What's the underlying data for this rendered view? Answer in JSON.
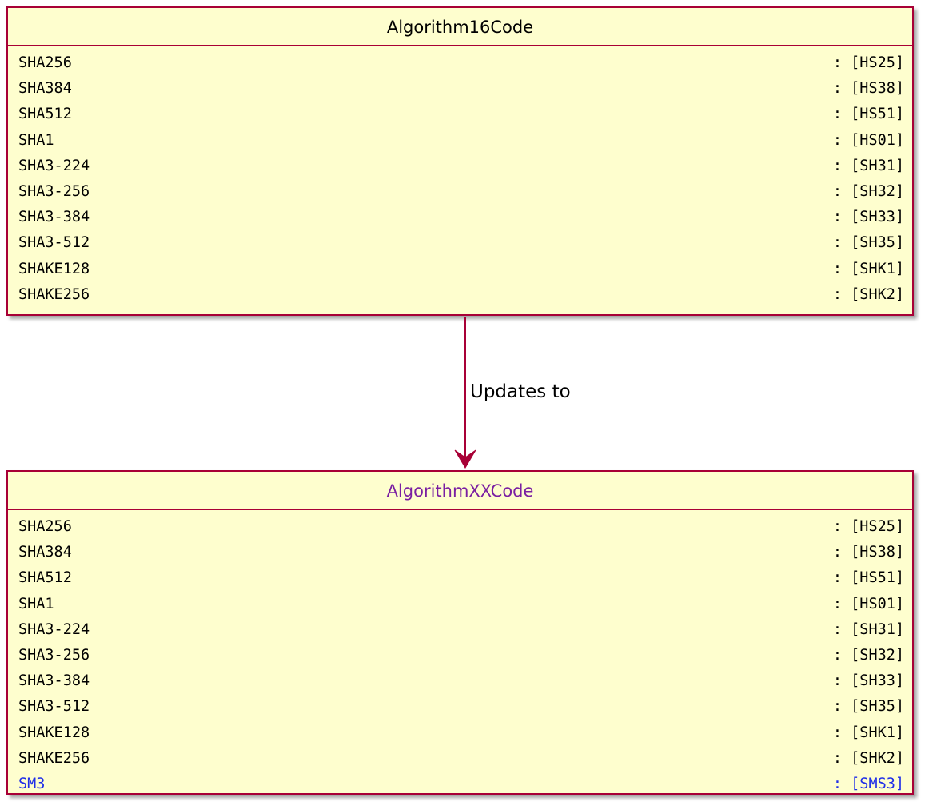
{
  "source_class": {
    "name": "Algorithm16Code",
    "attributes": [
      {
        "name": "SHA256",
        "value": ": [HS25]"
      },
      {
        "name": "SHA384",
        "value": ": [HS38]"
      },
      {
        "name": "SHA512",
        "value": ": [HS51]"
      },
      {
        "name": "SHA1",
        "value": ": [HS01]"
      },
      {
        "name": "SHA3-224",
        "value": ": [SH31]"
      },
      {
        "name": "SHA3-256",
        "value": ": [SH32]"
      },
      {
        "name": "SHA3-384",
        "value": ": [SH33]"
      },
      {
        "name": "SHA3-512",
        "value": ": [SH35]"
      },
      {
        "name": "SHAKE128",
        "value": ": [SHK1]"
      },
      {
        "name": "SHAKE256",
        "value": ": [SHK2]"
      }
    ]
  },
  "relation": {
    "label": "Updates to"
  },
  "target_class": {
    "name": "AlgorithmXXCode",
    "attributes": [
      {
        "name": "SHA256",
        "value": ": [HS25]"
      },
      {
        "name": "SHA384",
        "value": ": [HS38]"
      },
      {
        "name": "SHA512",
        "value": ": [HS51]"
      },
      {
        "name": "SHA1",
        "value": ": [HS01]"
      },
      {
        "name": "SHA3-224",
        "value": ": [SH31]"
      },
      {
        "name": "SHA3-256",
        "value": ": [SH32]"
      },
      {
        "name": "SHA3-384",
        "value": ": [SH33]"
      },
      {
        "name": "SHA3-512",
        "value": ": [SH35]"
      },
      {
        "name": "SHAKE128",
        "value": ": [SHK1]"
      },
      {
        "name": "SHAKE256",
        "value": ": [SHK2]"
      },
      {
        "name": "SM3",
        "value": ": [SMS3]"
      }
    ]
  },
  "colors": {
    "class_fill": "#fefece",
    "class_border": "#a80036",
    "target_title": "#7a1fa2",
    "added_attribute": "#1f2ee8"
  }
}
